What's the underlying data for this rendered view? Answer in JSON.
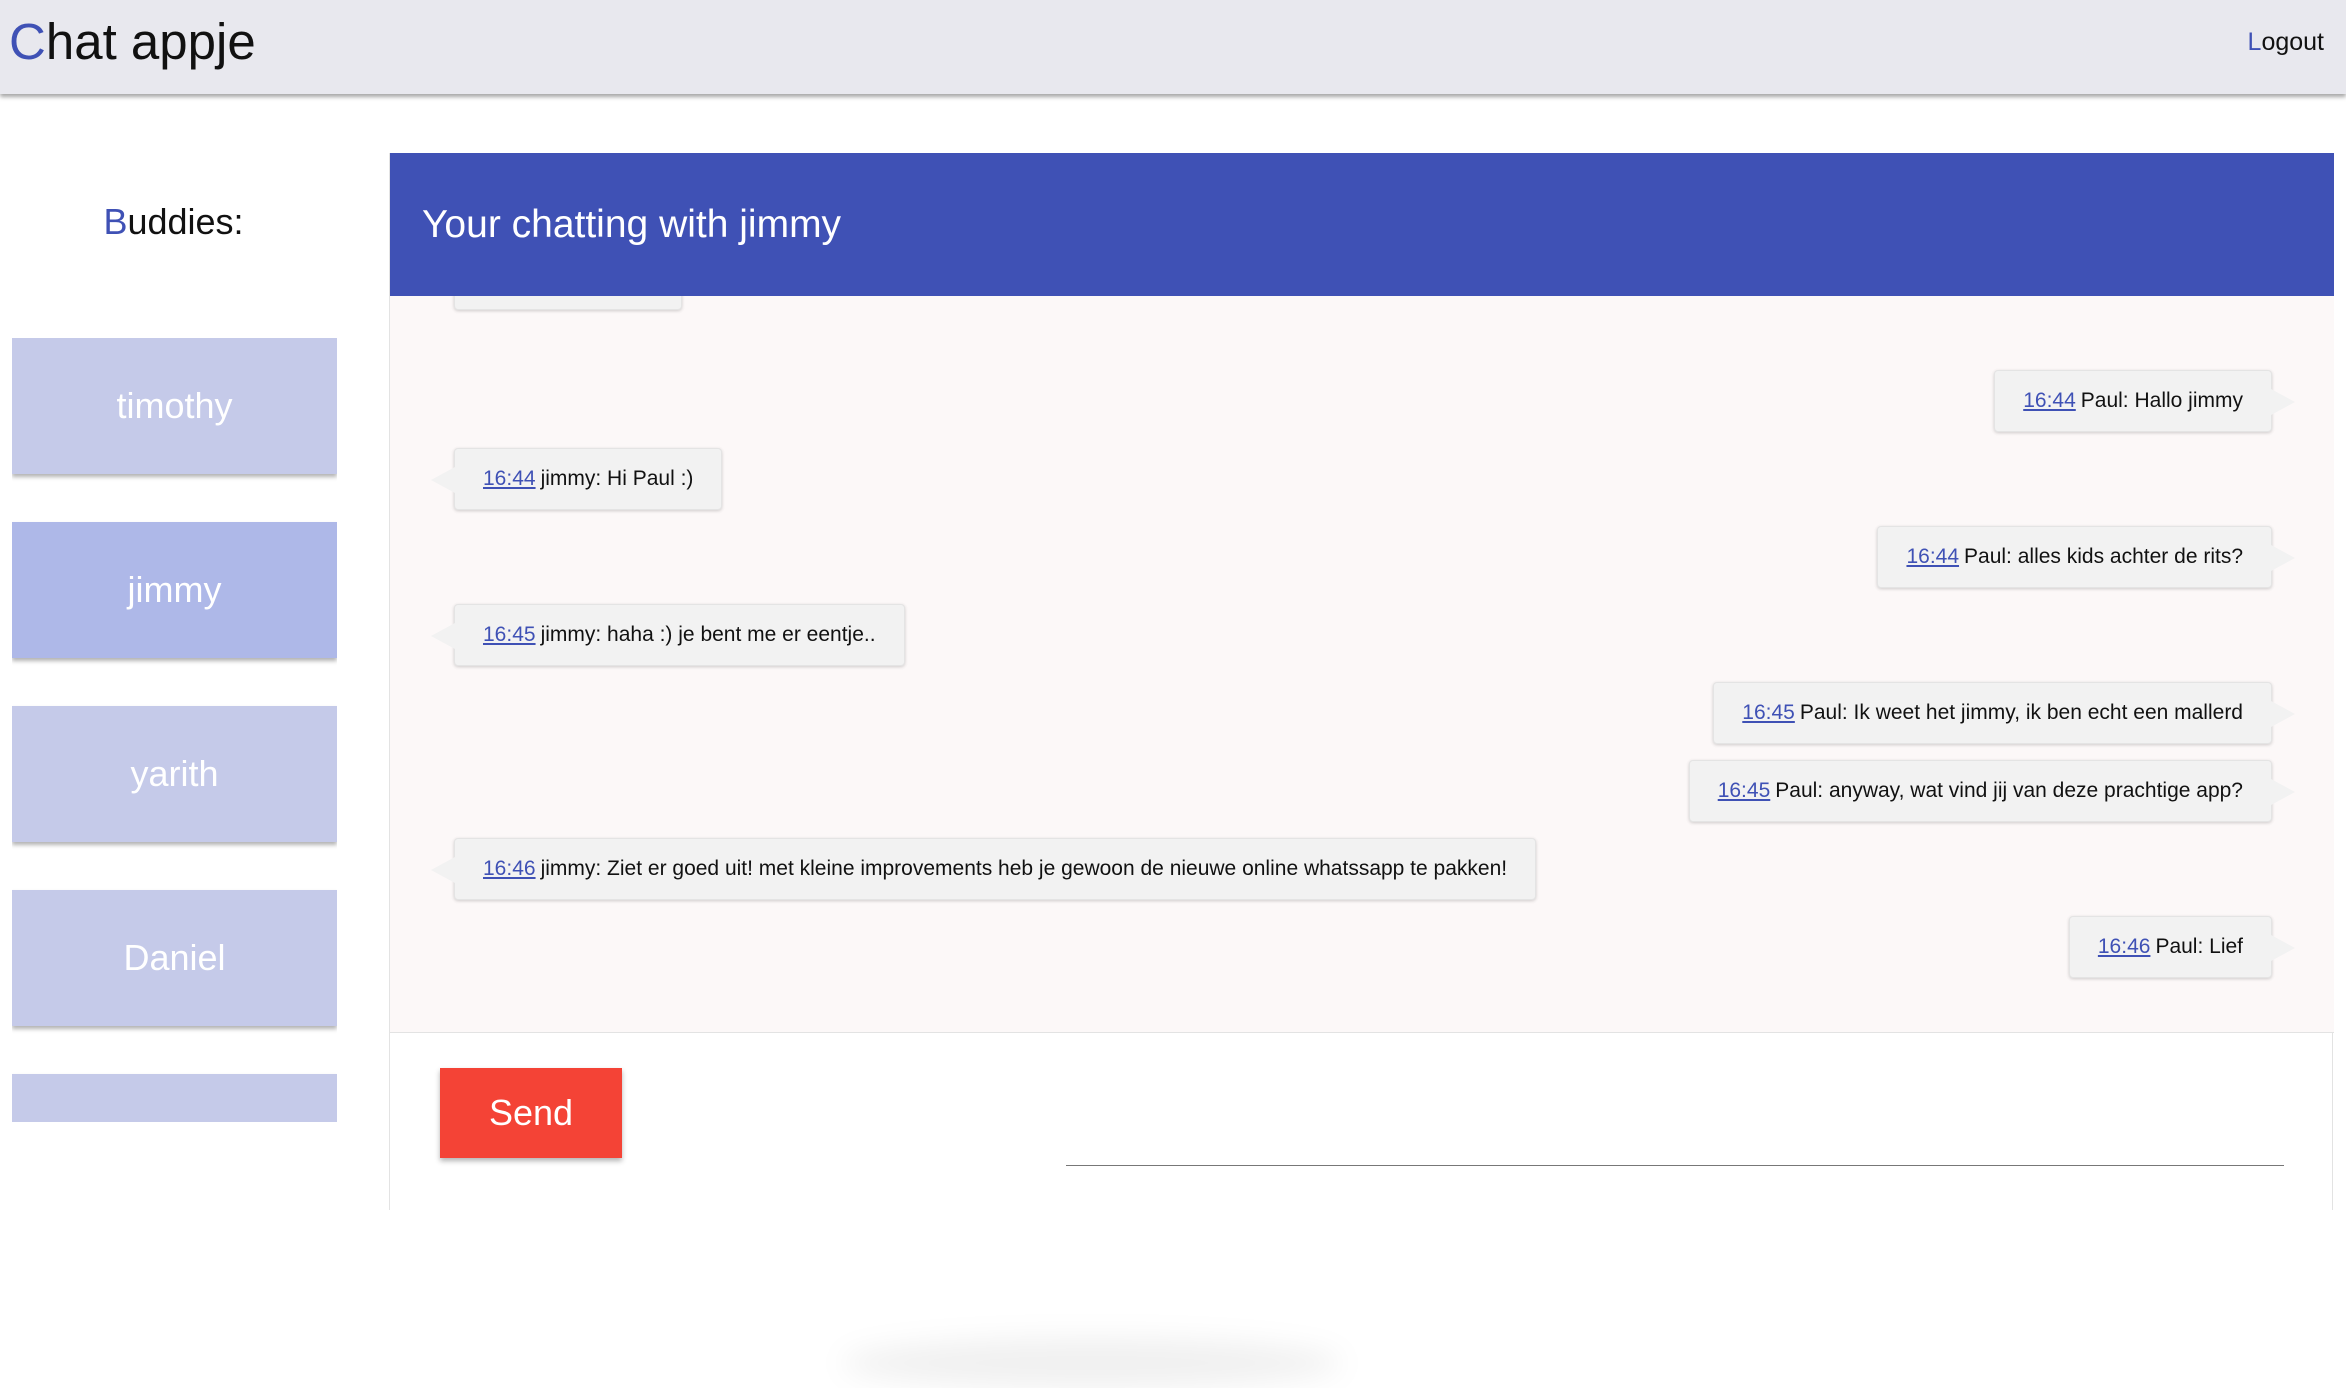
{
  "header": {
    "brand_first": "C",
    "brand_rest": "hat appje",
    "logout_first": "L",
    "logout_rest": "ogout"
  },
  "sidebar": {
    "title_first": "B",
    "title_rest": "uddies:",
    "buddies": [
      {
        "name": "timothy",
        "active": false
      },
      {
        "name": "jimmy",
        "active": true
      },
      {
        "name": "yarith",
        "active": false
      },
      {
        "name": "Daniel",
        "active": false
      },
      {
        "name": "",
        "active": false
      }
    ]
  },
  "chat": {
    "title": "Your chatting with jimmy",
    "messages": [
      {
        "side": "right",
        "time": "16:44",
        "text": "Paul: Hallo jimmy"
      },
      {
        "side": "left",
        "time": "16:44",
        "text": "jimmy: Hi Paul :)"
      },
      {
        "side": "right",
        "time": "16:44",
        "text": "Paul: alles kids achter de rits?"
      },
      {
        "side": "left",
        "time": "16:45",
        "text": "jimmy: haha :) je bent me er eentje.."
      },
      {
        "side": "right",
        "time": "16:45",
        "text": "Paul: Ik weet het jimmy, ik ben echt een mallerd"
      },
      {
        "side": "right",
        "time": "16:45",
        "text": "Paul: anyway, wat vind jij van deze prachtige app?"
      },
      {
        "side": "left",
        "time": "16:46",
        "text": "jimmy: Ziet er goed uit! met kleine improvements heb je gewoon de nieuwe online whatssapp te pakken!"
      },
      {
        "side": "right",
        "time": "16:46",
        "text": "Paul: Lief"
      }
    ]
  },
  "composer": {
    "send_label": "Send",
    "input_value": ""
  },
  "colors": {
    "accent": "#3f51b5",
    "send": "#f44336",
    "buddy": "#c5cae9",
    "buddy_active": "#aeb8e8"
  }
}
